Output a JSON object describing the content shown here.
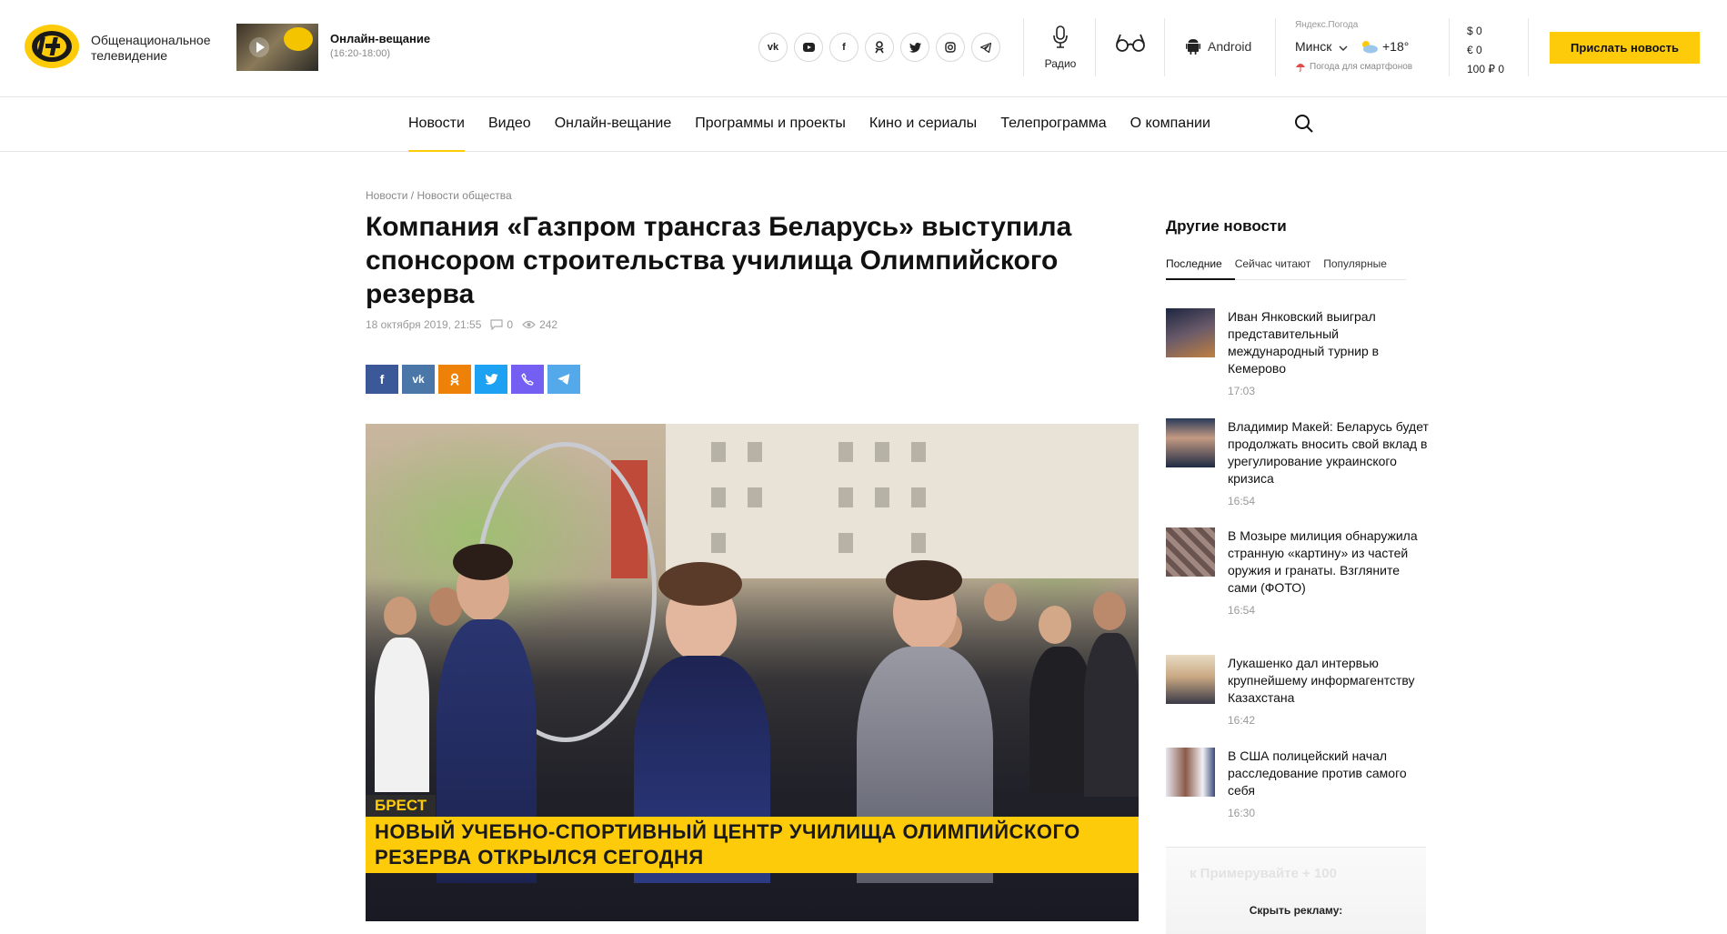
{
  "header": {
    "brand_text": "Общенациональное телевидение",
    "live_title": "Онлайн-вещание",
    "live_time": "(16:20-18:00)",
    "social": [
      "vk",
      "youtube",
      "facebook",
      "odnoklassniki",
      "twitter",
      "instagram",
      "telegram"
    ],
    "radio_label": "Радио",
    "android_label": "Android",
    "weather_source": "Яндекс.Погода",
    "weather_city": "Минск",
    "weather_temp": "+18°",
    "weather_phones": "Погода для смартфонов",
    "rate_usd": "$  0",
    "rate_eur": "€  0",
    "rate_rub": "100 ₽  0",
    "send_news_label": "Прислать новость",
    "accent_color": "#fecb0a"
  },
  "nav": {
    "items": [
      "Новости",
      "Видео",
      "Онлайн-вещание",
      "Программы и проекты",
      "Кино и сериалы",
      "Телепрограмма",
      "О компании"
    ],
    "active_index": 0
  },
  "article": {
    "breadcrumb_1": "Новости",
    "breadcrumb_sep": "/",
    "breadcrumb_2": "Новости общества",
    "title": "Компания «Газпром трансгаз Беларусь» выступила спонсором строительства училища Олимпийского резерва",
    "date": "18 октября 2019, 21:55",
    "comments": "0",
    "views": "242",
    "share": [
      {
        "name": "facebook",
        "color": "#3b5998"
      },
      {
        "name": "vk",
        "color": "#4a76a8"
      },
      {
        "name": "odnoklassniki",
        "color": "#ee8208"
      },
      {
        "name": "twitter",
        "color": "#1da1f2"
      },
      {
        "name": "viber",
        "color": "#7360f2"
      },
      {
        "name": "telegram",
        "color": "#54a9eb"
      }
    ],
    "caption_tag": "БРЕСТ",
    "caption_line1": "НОВЫЙ УЧЕБНО-СПОРТИВНЫЙ ЦЕНТР УЧИЛИЩА ОЛИМПИЙСКОГО",
    "caption_line2": "РЕЗЕРВА ОТКРЫЛСЯ СЕГОДНЯ"
  },
  "sidebar": {
    "title": "Другие новости",
    "tabs": [
      "Последние",
      "Сейчас читают",
      "Популярные"
    ],
    "news": [
      {
        "title": "Иван Янковский выиграл представительный международный турнир в Кемерово",
        "time": "17:03"
      },
      {
        "title": "Владимир Макей: Беларусь будет продолжать вносить свой вклад в урегулирование украинского кризиса",
        "time": "16:54"
      },
      {
        "title": "В Мозыре милиция обнаружила странную «картину» из частей оружия и гранаты. Взгляните сами (ФОТО)",
        "time": "16:54"
      },
      {
        "title": "Лукашенко дал интервью крупнейшему информагентству Казахстана",
        "time": "16:42"
      },
      {
        "title": "В США полицейский начал расследование против самого себя",
        "time": "16:30"
      }
    ],
    "ad_faded_text": "к Примерувайте + 100",
    "ad_hide_label": "Скрыть рекламу:"
  }
}
